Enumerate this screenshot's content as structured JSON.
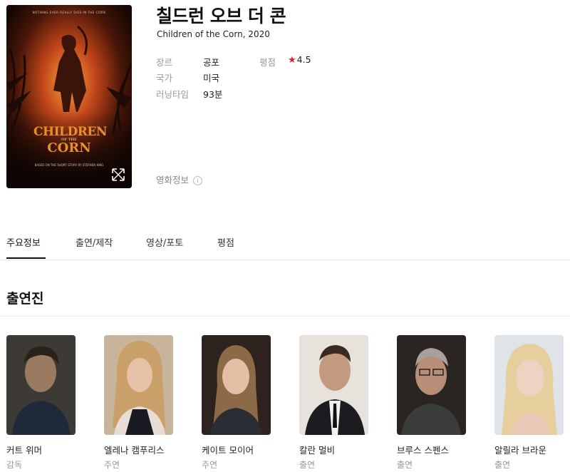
{
  "movie": {
    "title": "칠드런 오브 더 콘",
    "subtitle": "Children of the Corn, 2020",
    "poster": {
      "tagline": "NOTHING EVER REALLY DIES IN THE CORN",
      "logo_line1": "CHILDREN",
      "logo_line2": "OF THE",
      "logo_line3": "CORN",
      "based_on": "BASED ON THE SHORT STORY BY STEPHEN KING"
    },
    "info": [
      {
        "label": "장르",
        "value": "공포"
      },
      {
        "label": "국가",
        "value": "미국"
      },
      {
        "label": "러닝타임",
        "value": "93분"
      }
    ],
    "rating_label": "평점",
    "rating_value": "4.5",
    "more_info_label": "영화정보",
    "info_icon_glyph": "i"
  },
  "tabs": [
    "주요정보",
    "출연/제작",
    "영상/포토",
    "평점"
  ],
  "cast_section_title": "출연진",
  "cast": [
    {
      "name": "커트 위머",
      "role": "감독"
    },
    {
      "name": "엘레나 캠푸리스",
      "role": "주연"
    },
    {
      "name": "케이트 모이어",
      "role": "주연"
    },
    {
      "name": "칼란 멀비",
      "role": "출연"
    },
    {
      "name": "브루스 스펜스",
      "role": "출연"
    },
    {
      "name": "알릴라 브라운",
      "role": "출연"
    }
  ],
  "colors": {
    "star": "#e31b23",
    "tab_underline": "#111111",
    "poster_logo": "#e8902a"
  }
}
